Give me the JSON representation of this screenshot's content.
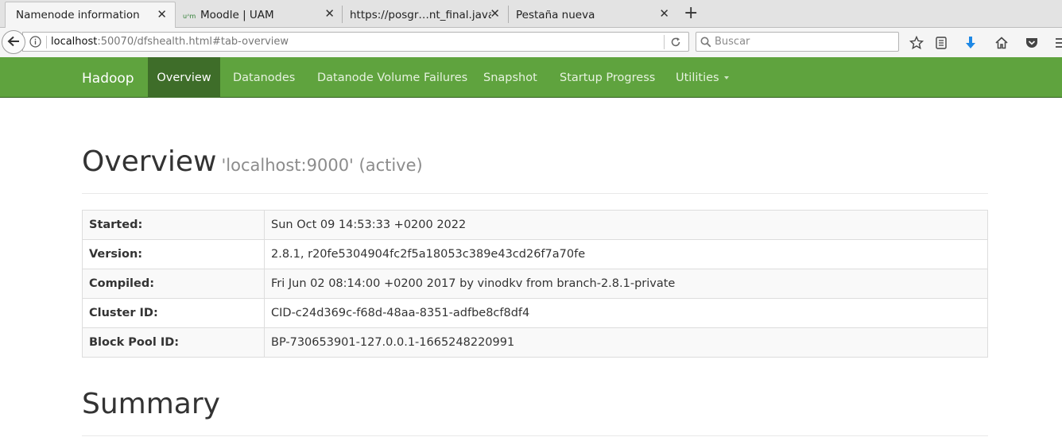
{
  "browser": {
    "tabs": [
      {
        "title": "Namenode information",
        "active": true
      },
      {
        "title": "Moodle | UAM",
        "active": false,
        "favicon": "uam-icon"
      },
      {
        "title": "https://posgr…nt_final.java",
        "active": false
      },
      {
        "title": "Pestaña nueva",
        "active": false
      }
    ],
    "new_tab_label": "+",
    "url_host": "localhost",
    "url_rest": ":50070/dfshealth.html#tab-overview",
    "search_placeholder": "Buscar"
  },
  "hadoop_nav": {
    "brand": "Hadoop",
    "items": [
      {
        "label": "Overview",
        "active": true
      },
      {
        "label": "Datanodes"
      },
      {
        "label": "Datanode Volume Failures"
      },
      {
        "label": "Snapshot"
      },
      {
        "label": "Startup Progress"
      },
      {
        "label": "Utilities",
        "dropdown": true
      }
    ]
  },
  "overview": {
    "title": "Overview",
    "subtitle": "'localhost:9000' (active)",
    "rows": [
      {
        "label": "Started:",
        "value": "Sun Oct 09 14:53:33 +0200 2022"
      },
      {
        "label": "Version:",
        "value": "2.8.1, r20fe5304904fc2f5a18053c389e43cd26f7a70fe"
      },
      {
        "label": "Compiled:",
        "value": "Fri Jun 02 08:14:00 +0200 2017 by vinodkv from branch-2.8.1-private"
      },
      {
        "label": "Cluster ID:",
        "value": "CID-c24d369c-f68d-48aa-8351-adfbe8cf8df4"
      },
      {
        "label": "Block Pool ID:",
        "value": "BP-730653901-127.0.0.1-1665248220991"
      }
    ]
  },
  "summary": {
    "title": "Summary"
  },
  "colors": {
    "navbar_green": "#5fa33e",
    "navbar_active": "#3e6d29",
    "download_blue": "#1e88e5"
  }
}
